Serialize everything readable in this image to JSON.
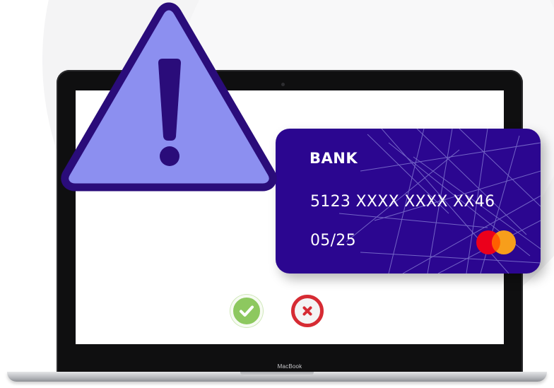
{
  "laptop": {
    "brand_label": "MacBook"
  },
  "card": {
    "bank": "BANK",
    "number": "5123 XXXX XXXX XX46",
    "expiry": "05/25",
    "network_icon": "mastercard-logo-icon",
    "color": "#2b0690"
  },
  "status": {
    "approve_icon": "check-icon",
    "approve_color": "#8dc85f",
    "decline_icon": "x-icon",
    "decline_color": "#d62b33"
  },
  "warning": {
    "icon": "warning-triangle-icon",
    "fill_color": "#8c8ff0",
    "outline_color": "#2a0c7a"
  }
}
